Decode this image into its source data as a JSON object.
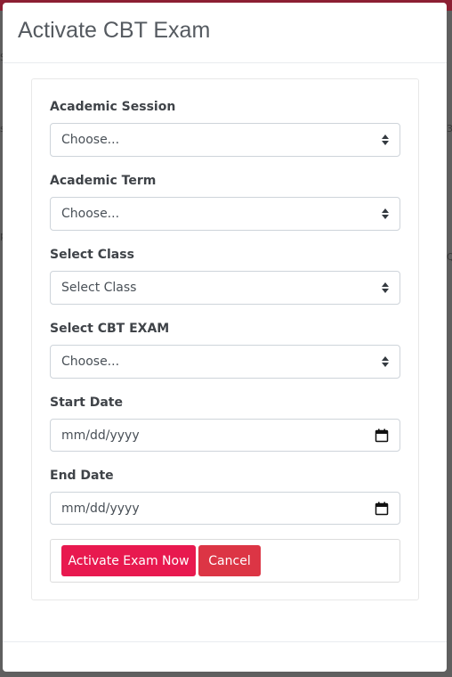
{
  "modal": {
    "title": "Activate CBT Exam"
  },
  "form": {
    "session": {
      "label": "Academic Session",
      "value": "Choose..."
    },
    "term": {
      "label": "Academic Term",
      "value": "Choose..."
    },
    "class": {
      "label": "Select Class",
      "value": "Select Class"
    },
    "exam": {
      "label": "Select CBT EXAM",
      "value": "Choose..."
    },
    "start_date": {
      "label": "Start Date",
      "placeholder": "mm/dd/yyyy"
    },
    "end_date": {
      "label": "End Date",
      "placeholder": "mm/dd/yyyy"
    }
  },
  "actions": {
    "activate_label": "Activate Exam Now",
    "cancel_label": "Cancel"
  },
  "colors": {
    "topbar": "#8c1f33",
    "activate_button": "#e8194f",
    "cancel_button": "#dc3545"
  }
}
